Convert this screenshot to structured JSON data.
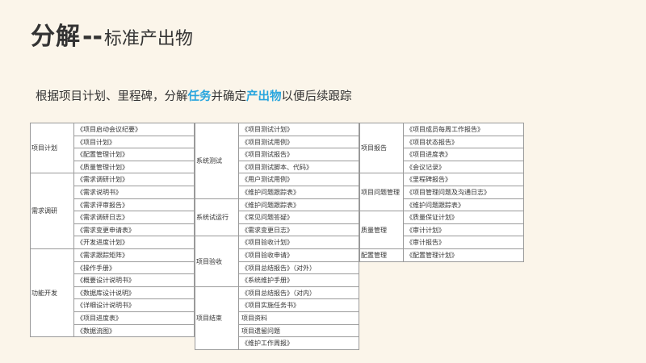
{
  "title": {
    "main": "分解",
    "sep": "--",
    "sub": "标准产出物"
  },
  "subtitle": {
    "p1": "根据项目计划、里程碑，分解",
    "hl1": "任务",
    "p2": "并确定",
    "hl2": "产出物",
    "p3": "以便后续跟踪"
  },
  "colors": {
    "accent": "#2aa6de",
    "background": "#fbf5ea"
  },
  "tables": [
    {
      "groups": [
        {
          "label": "项目计划",
          "items": [
            "《项目启动会议纪要》",
            "《项目计划》",
            "《配置管理计划》",
            "《质量管理计划》"
          ]
        },
        {
          "label": "需求调研",
          "items": [
            "《需求调研计划》",
            "《需求说明书》",
            "《需求评审报告》",
            "《需求调研日志》",
            "《需求变更申请表》",
            "《开发进度计划》"
          ]
        },
        {
          "label": "功能开发",
          "items": [
            "《需求跟踪矩阵》",
            "《操作手册》",
            "《概要设计说明书》",
            "《数据库设计说明》",
            "《详细设计说明书》",
            "《项目进度表》",
            "《数据流图》"
          ]
        }
      ]
    },
    {
      "groups": [
        {
          "label": "系统测试",
          "items": [
            "《项目测试计划》",
            "《项目测试用例》",
            "《项目测试报告》",
            "《项目测试脚本、代码》",
            "《用户测试用例》",
            "《维护问题跟踪表》"
          ]
        },
        {
          "label": "系统试运行",
          "items": [
            "《维护问题跟踪表》",
            "《常见问题答疑》",
            "《需求变更日志》"
          ]
        },
        {
          "label": "项目验收",
          "items": [
            "《项目验收计划》",
            "《项目验收申请》",
            "《项目总结报告》（对外）",
            "《系统维护手册》"
          ]
        },
        {
          "label": "项目结束",
          "items": [
            "《项目总结报告》（对内）",
            "《项目实施任务书》",
            "项目资料",
            "项目遗留问题",
            "《维护工作周报》"
          ]
        }
      ]
    },
    {
      "groups": [
        {
          "label": "项目报告",
          "items": [
            "《项目成员每周工作报告》",
            "《项目状态报告》",
            "《项目进度表》",
            "《会议记录》"
          ]
        },
        {
          "label": "项目问题管理",
          "items": [
            "《里程碑报告》",
            "《项目管理问题及沟通日志》",
            "《维护问题跟踪表》"
          ]
        },
        {
          "label": "质量管理",
          "items": [
            "《质量保证计划》",
            "《审计计划》",
            "《审计报告》"
          ]
        },
        {
          "label": "配置管理",
          "items": [
            "《配置管理计划》"
          ]
        }
      ]
    }
  ]
}
